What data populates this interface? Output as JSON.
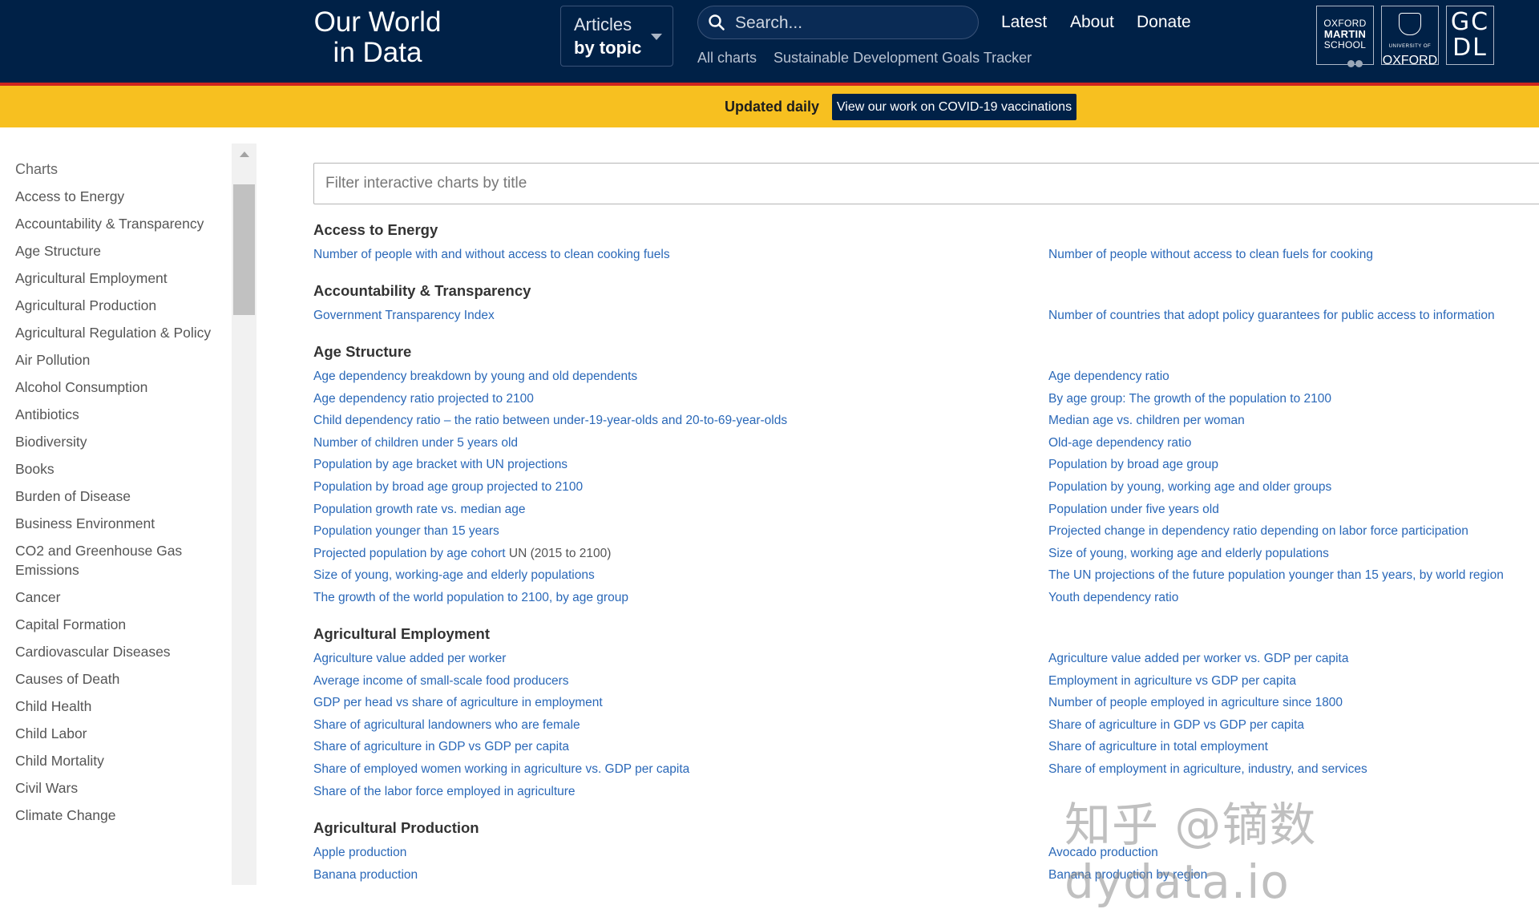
{
  "header": {
    "logo_line1": "Our World",
    "logo_line2": "in Data",
    "topics_line1": "Articles",
    "topics_line2": "by topic",
    "search_placeholder": "Search...",
    "nav": [
      "Latest",
      "About",
      "Donate"
    ],
    "subnav": [
      "All charts",
      "Sustainable Development Goals Tracker"
    ],
    "partners": {
      "oms": [
        "OXFORD",
        "MARTIN",
        "SCHOOL"
      ],
      "oxford_small": "UNIVERSITY OF",
      "oxford": "OXFORD",
      "gcdl_top": "GC",
      "gcdl_bottom": "DL"
    }
  },
  "banner": {
    "text": "Updated daily",
    "button": "View our work on COVID-19 vaccinations"
  },
  "sidebar": {
    "heading": "Charts",
    "items": [
      "Access to Energy",
      "Accountability & Transparency",
      "Age Structure",
      "Agricultural Employment",
      "Agricultural Production",
      "Agricultural Regulation & Policy",
      "Air Pollution",
      "Alcohol Consumption",
      "Antibiotics",
      "Biodiversity",
      "Books",
      "Burden of Disease",
      "Business Environment",
      "CO2 and Greenhouse Gas Emissions",
      "Cancer",
      "Capital Formation",
      "Cardiovascular Diseases",
      "Causes of Death",
      "Child Health",
      "Child Labor",
      "Child Mortality",
      "Civil Wars",
      "Climate Change"
    ]
  },
  "main": {
    "filter_placeholder": "Filter interactive charts by title",
    "sections": [
      {
        "title": "Access to Energy",
        "left": [
          "Number of people with and without access to clean cooking fuels"
        ],
        "right": [
          "Number of people without access to clean fuels for cooking"
        ]
      },
      {
        "title": "Accountability & Transparency",
        "left": [
          "Government Transparency Index"
        ],
        "right": [
          "Number of countries that adopt policy guarantees for public access to information"
        ]
      },
      {
        "title": "Age Structure",
        "left": [
          "Age dependency breakdown by young and old dependents",
          "Age dependency ratio projected to 2100",
          "Child dependency ratio – the ratio between under-19-year-olds and 20-to-69-year-olds",
          "Number of children under 5 years old",
          "Population by age bracket with UN projections",
          "Population by broad age group projected to 2100",
          "Population growth rate vs. median age",
          "Population younger than 15 years",
          "Projected population by age cohort",
          "Size of young, working-age and elderly populations",
          "The growth of the world population to 2100, by age group"
        ],
        "left_note": "UN (2015 to 2100)",
        "right": [
          "Age dependency ratio",
          "By age group: The growth of the population to 2100",
          "Median age vs. children per woman",
          "Old-age dependency ratio",
          "Population by broad age group",
          "Population by young, working age and older groups",
          "Population under five years old",
          "Projected change in dependency ratio depending on labor force participation",
          "Size of young, working age and elderly populations",
          "The UN projections of the future population younger than 15 years, by world region",
          "Youth dependency ratio"
        ]
      },
      {
        "title": "Agricultural Employment",
        "left": [
          "Agriculture value added per worker",
          "Average income of small-scale food producers",
          "GDP per head vs share of agriculture in employment",
          "Share of agricultural landowners who are female",
          "Share of agriculture in GDP vs GDP per capita",
          "Share of employed women working in agriculture vs. GDP per capita",
          "Share of the labor force employed in agriculture"
        ],
        "right": [
          "Agriculture value added per worker vs. GDP per capita",
          "Employment in agriculture vs GDP per capita",
          "Number of people employed in agriculture since 1800",
          "Share of agriculture in GDP vs GDP per capita",
          "Share of agriculture in total employment",
          "Share of employment in agriculture, industry, and services"
        ]
      },
      {
        "title": "Agricultural Production",
        "left": [
          "Apple production",
          "Banana production"
        ],
        "right": [
          "Avocado production",
          "Banana production by region"
        ]
      }
    ]
  },
  "watermark": "知乎 @镝数dydata.io"
}
